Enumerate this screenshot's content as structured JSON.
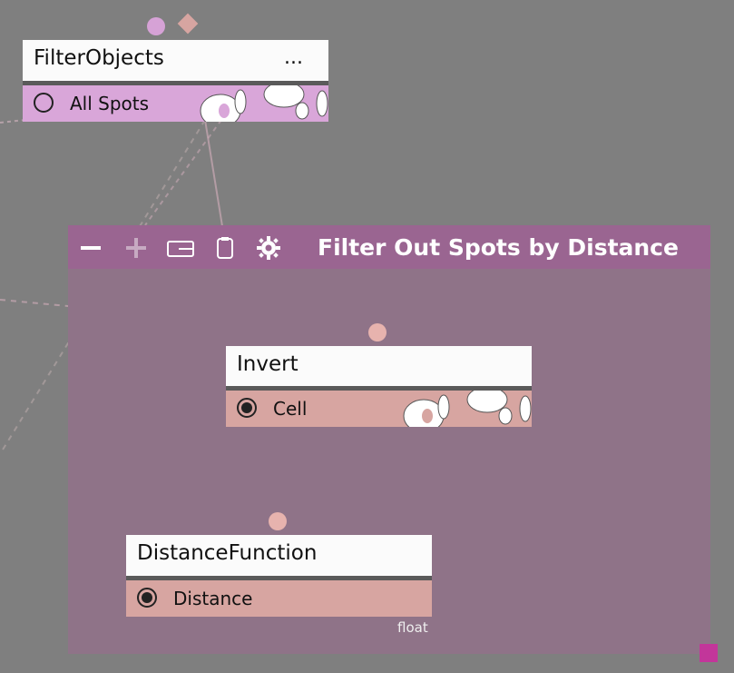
{
  "nodes": {
    "filter_objects": {
      "title": "FilterObjects",
      "menu": "...",
      "port_label": "All Spots"
    },
    "invert": {
      "title": "Invert",
      "port_label": "Cell"
    },
    "distance_function": {
      "title": "DistanceFunction",
      "port_label": "Distance",
      "type_hint": "float"
    }
  },
  "group": {
    "title": "Filter Out Spots by Distance",
    "toolbar": [
      "minus-icon",
      "plus-icon",
      "wallet-icon",
      "clipboard-icon",
      "gear-icon"
    ]
  },
  "colors": {
    "background": "#7f7f7f",
    "group_body": "#8f7388",
    "group_header": "#9a6591",
    "filter_port_row": "#d9a6d9",
    "invert_port_row": "#d7a5a1",
    "distance_port_row": "#d7a5a1",
    "corner_marker": "#c2369a"
  }
}
